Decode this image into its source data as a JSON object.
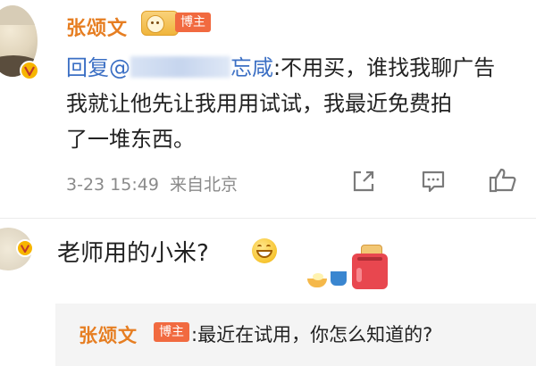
{
  "comment1": {
    "author": "张颂文",
    "badge": "博主",
    "text_prefix": "回复@",
    "mention_visible_suffix": "忘咸",
    "text_after_mention": ":不用买，谁找我聊广告",
    "text_line2": "我就让他先让我用用试试，我最近免费拍",
    "text_line3": "了一堆东西。",
    "timestamp": "3-23 15:49",
    "location": "来自北京",
    "icons": [
      "share-icon",
      "comment-icon",
      "like-icon",
      "verified-v-icon",
      "level-smile-icon"
    ]
  },
  "comment2": {
    "text": "老师用的小米?",
    "emoji": "grinning-face-emoji",
    "sticker": "breakfast-sticker"
  },
  "reply": {
    "author": "张颂文",
    "badge": "博主",
    "text": ":最近在试用，你怎么知道的?"
  },
  "colors": {
    "username": "#e67e22",
    "badge_bg": "#f16a40",
    "mention": "#3b6fc4",
    "meta": "#8a8a8a",
    "verified": "#f7b500"
  }
}
